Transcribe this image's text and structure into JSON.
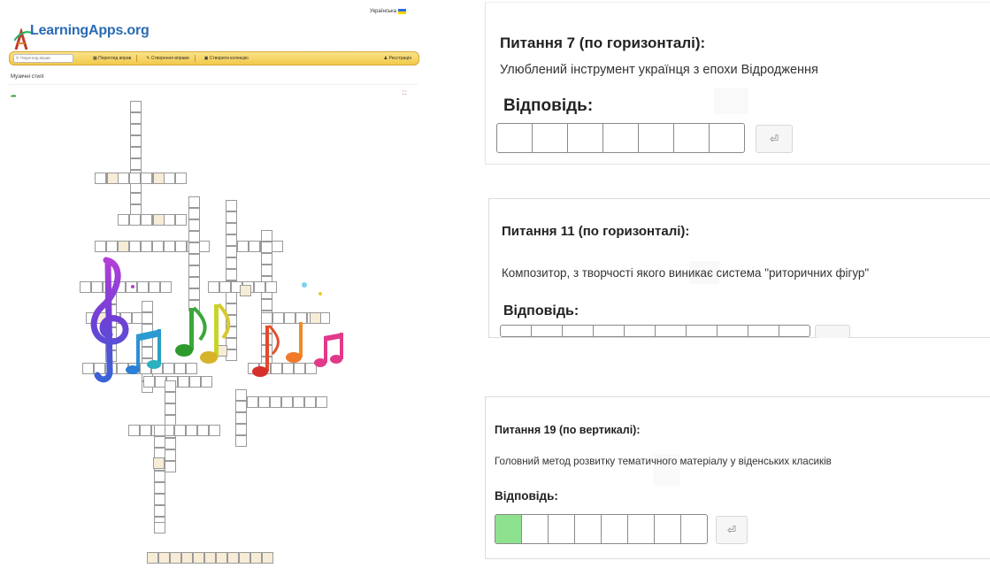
{
  "learningapps": {
    "language": "Українська",
    "logo": "LearningApps.org",
    "search_placeholder": "Перегляд вправ",
    "nav": [
      {
        "icon": "grid-icon",
        "label": "Перегляд вправ"
      },
      {
        "icon": "pencil-icon",
        "label": "Створення вправи"
      },
      {
        "icon": "collection-icon",
        "label": "Створити колекцію"
      }
    ],
    "register": "Реєстрація",
    "subtitle": "Музичні стилі",
    "accent": "#f2c94a"
  },
  "questions": [
    {
      "title": "Питання 7 (по горизонталі):",
      "text": "Улюблений інструмент українця з епохи Відродження",
      "answer_label": "Відповідь:",
      "letters": 7,
      "filled": 0
    },
    {
      "title": "Питання 11 (по горизонталі):",
      "text": "Композитор, з творчості якого виникає система \"риторичних фігур\"",
      "answer_label": "Відповідь:",
      "letters": 10,
      "filled": 0
    },
    {
      "title": "Питання 19 (по вертикалі):",
      "text": "Головний метод розвитку тематичного матеріалу у віденських класиків",
      "answer_label": "Відповідь:",
      "letters": 8,
      "filled": 1,
      "fill_color": "#8ee28f"
    }
  ]
}
